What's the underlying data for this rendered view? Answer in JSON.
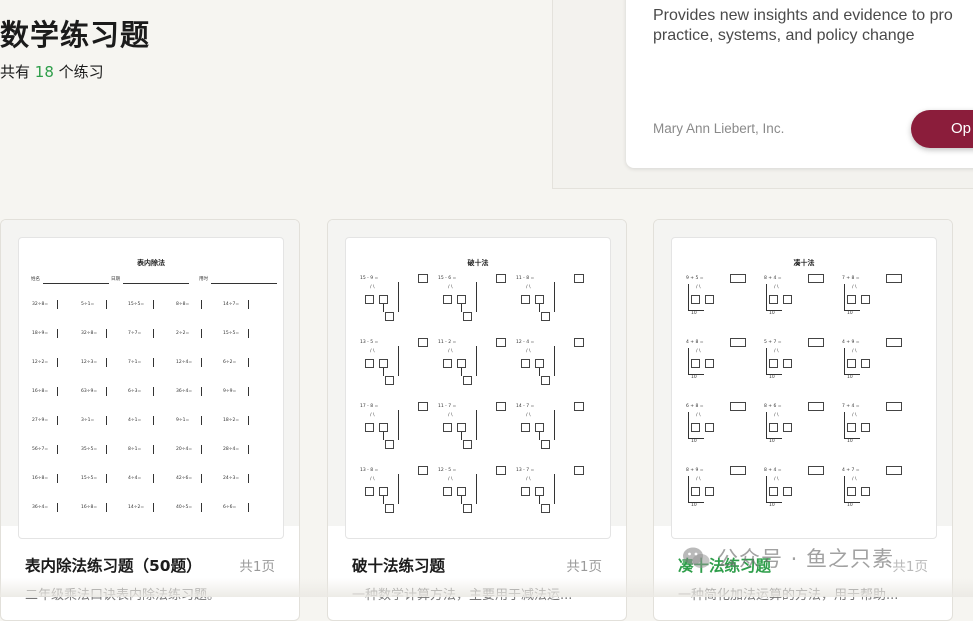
{
  "header": {
    "title": "数学练习题",
    "count_prefix": "共有",
    "count_value": "18",
    "count_suffix": "个练习"
  },
  "promo": {
    "description": "Provides new insights and evidence to pro practice, systems, and policy change",
    "publisher": "Mary Ann Liebert, Inc.",
    "button_label": "Op"
  },
  "cards": [
    {
      "sheet_title": "表内除法",
      "sheet_fields": [
        "姓名",
        "日期",
        "用时"
      ],
      "problems": [
        [
          "32÷8=",
          "5÷1=",
          "15÷5=",
          "8÷8=",
          "14÷7="
        ],
        [
          "18÷9=",
          "32÷8=",
          "7÷7=",
          "2÷2=",
          "15÷5="
        ],
        [
          "12÷2=",
          "12÷3=",
          "7÷1=",
          "12÷4=",
          "6÷2="
        ],
        [
          "16÷8=",
          "63÷9=",
          "6÷3=",
          "36÷4=",
          "9÷9="
        ],
        [
          "27÷9=",
          "3÷1=",
          "4÷1=",
          "9÷1=",
          "18÷2="
        ],
        [
          "56÷7=",
          "35÷5=",
          "8÷1=",
          "20÷4=",
          "28÷4="
        ],
        [
          "16÷8=",
          "15÷5=",
          "4÷4=",
          "42÷6=",
          "24÷3="
        ],
        [
          "36÷4=",
          "16÷8=",
          "14÷2=",
          "40÷5=",
          "6÷6="
        ]
      ],
      "title": "表内除法练习题（50题）",
      "pages": "共1页",
      "description": "二年级乘法口诀表内除法练习题。"
    },
    {
      "sheet_title": "破十法",
      "problems": [
        [
          "15 - 9 =",
          "15 - 6 =",
          "11 - 8 ="
        ],
        [
          "13 - 5 =",
          "11 - 2 =",
          "12 - 4 ="
        ],
        [
          "17 - 8 =",
          "11 - 7 =",
          "14 - 7 ="
        ],
        [
          "13 - 8 =",
          "12 - 5 =",
          "13 - 7 ="
        ]
      ],
      "title": "破十法练习题",
      "pages": "共1页",
      "description": "一种数学计算方法，主要用于减法运..."
    },
    {
      "sheet_title": "凑十法",
      "problems": [
        [
          "9 + 5 =",
          "8 + 4 =",
          "7 + 8 ="
        ],
        [
          "4 + 8 =",
          "5 + 7 =",
          "4 + 9 ="
        ],
        [
          "6 + 8 =",
          "8 + 6 =",
          "7 + 4 ="
        ],
        [
          "8 + 9 =",
          "8 + 4 =",
          "4 + 7 ="
        ]
      ],
      "ten_label": "10",
      "title": "凑十法练习题",
      "pages": "共1页",
      "description": "一种简化加法运算的方法，用于帮助..."
    }
  ],
  "watermark": {
    "text": "公众号 · 鱼之只素",
    "icon": "wechat-icon"
  },
  "colors": {
    "accent_green": "#2e9e4a",
    "button_red": "#8b1d3b",
    "background": "#f6f5f1"
  }
}
